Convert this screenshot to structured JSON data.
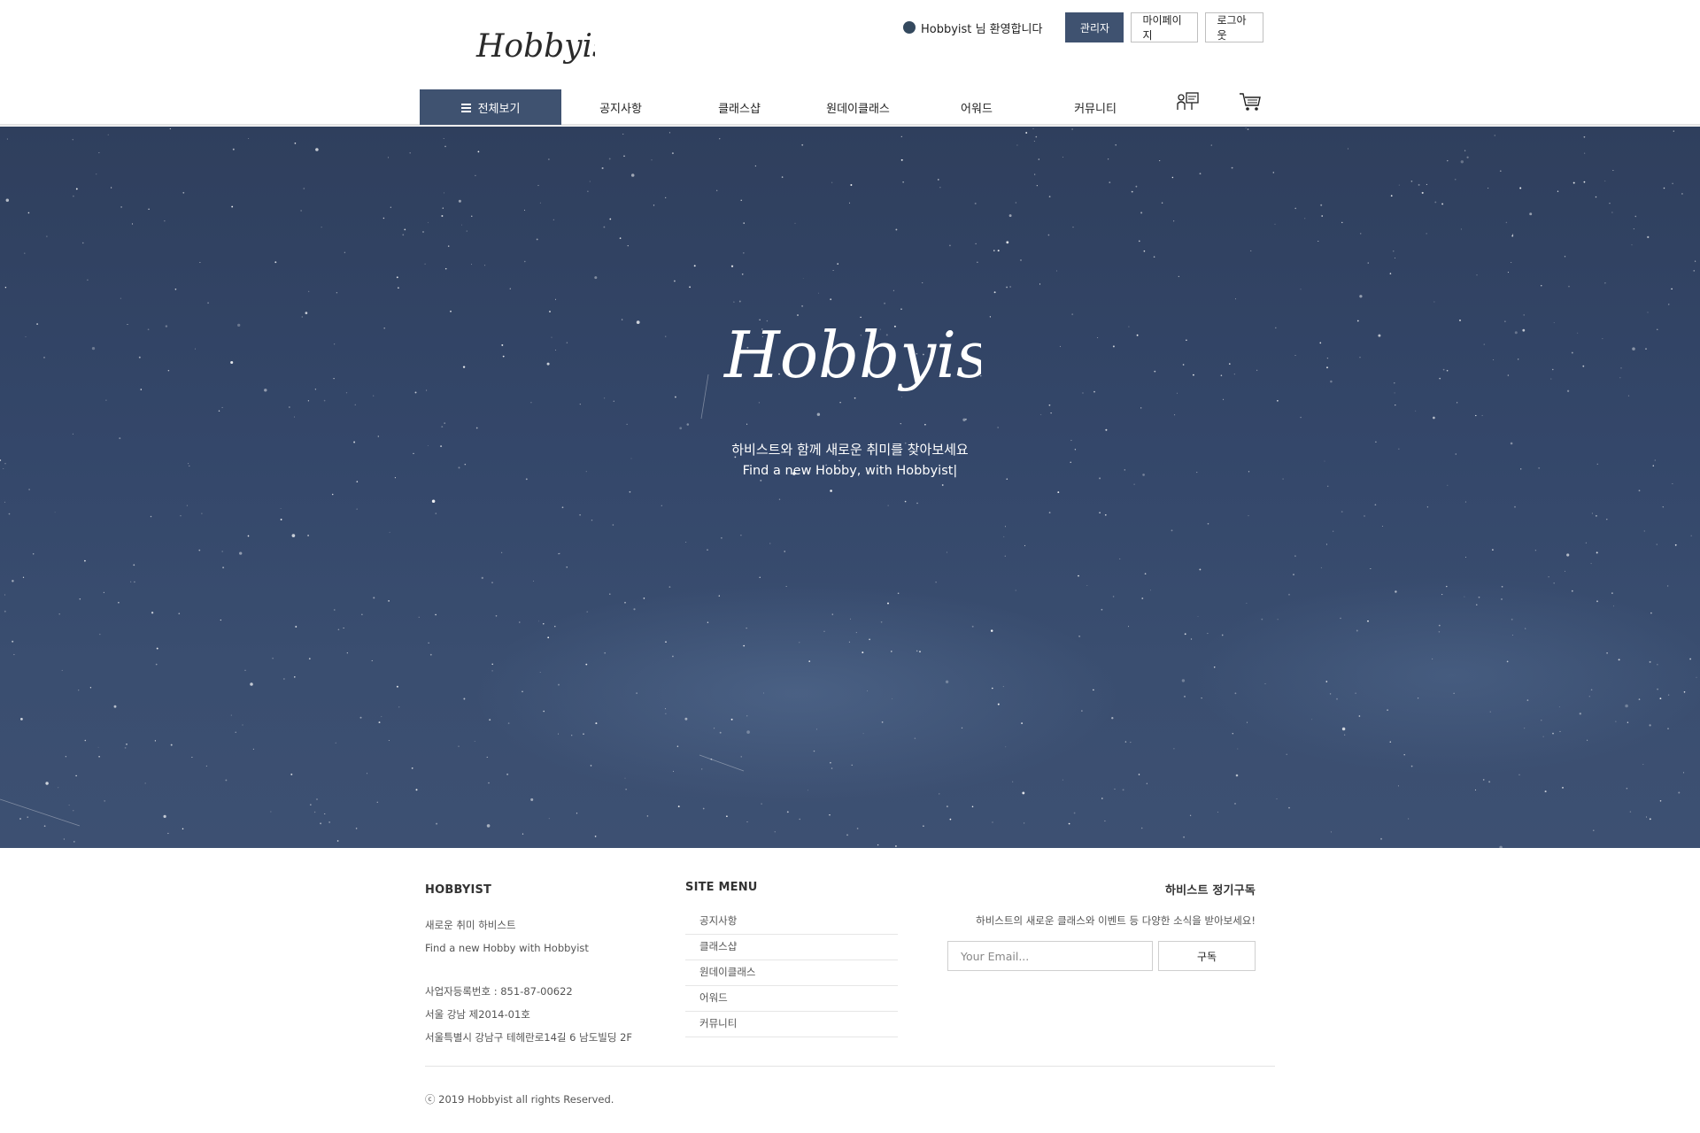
{
  "brand": {
    "logo_text": "Hobbyist"
  },
  "userbar": {
    "username": "Hobbyist",
    "welcome_suffix": "님 환영합니다",
    "admin_label": "관리자",
    "mypage_label": "마이페이지",
    "logout_label": "로그아웃"
  },
  "nav": {
    "all_label": "전체보기",
    "items": [
      "공지사항",
      "클래스샵",
      "원데이클래스",
      "어워드",
      "커뮤니티"
    ],
    "icons": [
      "class-board-icon",
      "cart-icon"
    ]
  },
  "hero": {
    "logo_text": "Hobbyist",
    "line1": "하비스트와 함께 새로운 취미를 찾아보세요",
    "line2": "Find a new Hobby, with Hobbyist|"
  },
  "footer": {
    "about": {
      "title": "HOBBYIST",
      "tagline_kr": "새로운 취미 하비스트",
      "tagline_en": "Find a new Hobby with Hobbyist",
      "biz_number": "사업자등록번호 : 851-87-00622",
      "registration": "서울 강남 제2014-01호",
      "address": "서울특별시 강남구 테헤란로14길 6 남도빌딩 2F"
    },
    "site_menu": {
      "title": "SITE MENU",
      "items": [
        "공지사항",
        "클래스샵",
        "원데이클래스",
        "어워드",
        "커뮤니티"
      ]
    },
    "subscribe": {
      "title": "하비스트 정기구독",
      "description": "하비스트의 새로운 클래스와 이벤트 등 다양한 소식을 받아보세요!",
      "placeholder": "Your Email...",
      "button_label": "구독"
    },
    "copyright": "ⓒ 2019 Hobbyist all rights Reserved."
  },
  "colors": {
    "accent": "#3f5270",
    "hero_bg": "#34476a"
  }
}
